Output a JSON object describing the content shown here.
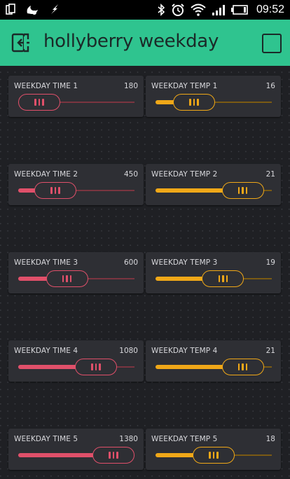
{
  "status_bar": {
    "time": "09:52",
    "icons": [
      "sim-card-icon",
      "weather-icon",
      "charging-bolt-icon",
      "bluetooth-icon",
      "alarm-icon",
      "wifi-icon",
      "signal-icon",
      "battery-icon"
    ]
  },
  "header": {
    "title": "hollyberry weekday",
    "background_color": "#2fc48f",
    "left_icon": "exit-project-icon",
    "right_icon": "square-icon"
  },
  "colors": {
    "time_slider": "#e0506a",
    "temp_slider": "#f0a818"
  },
  "time_sliders": [
    {
      "label": "WEEKDAY TIME 1",
      "value": "180",
      "fraction": 0.08
    },
    {
      "label": "WEEKDAY TIME 2",
      "value": "450",
      "fraction": 0.32
    },
    {
      "label": "WEEKDAY TIME 3",
      "value": "600",
      "fraction": 0.42
    },
    {
      "label": "WEEKDAY TIME 4",
      "value": "1080",
      "fraction": 0.67
    },
    {
      "label": "WEEKDAY TIME 5",
      "value": "1380",
      "fraction": 0.82
    }
  ],
  "temp_sliders": [
    {
      "label": "WEEKDAY TEMP 1",
      "value": "16",
      "fraction": 0.33
    },
    {
      "label": "WEEKDAY TEMP 2",
      "value": "21",
      "fraction": 0.75
    },
    {
      "label": "WEEKDAY TEMP 3",
      "value": "19",
      "fraction": 0.58
    },
    {
      "label": "WEEKDAY TEMP 4",
      "value": "21",
      "fraction": 0.75
    },
    {
      "label": "WEEKDAY TEMP 5",
      "value": "18",
      "fraction": 0.5
    }
  ]
}
